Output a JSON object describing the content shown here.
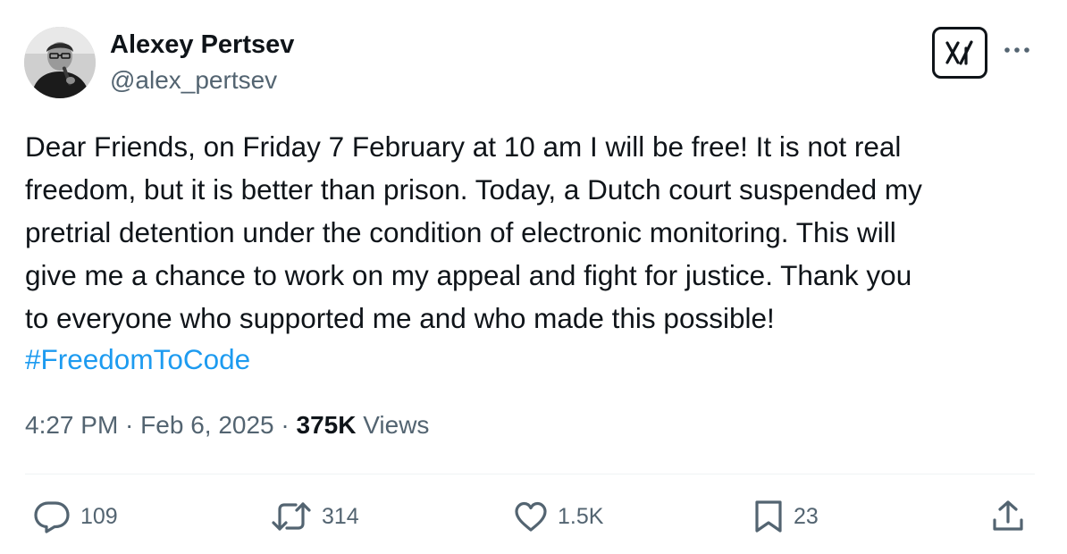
{
  "author": {
    "display_name": "Alexey Pertsev",
    "handle": "@alex_pertsev",
    "avatar_icon": "profile-photo"
  },
  "header_actions": {
    "grok_icon": "grok-icon",
    "more_icon": "more-icon"
  },
  "tweet": {
    "text": "Dear Friends, on Friday 7 February at 10 am I will be free! It is not real\nfreedom, but it is better than prison. Today, a Dutch court suspended my\npretrial detention under the condition of electronic monitoring. This will\ngive me a chance to work on my appeal and fight for justice. Thank you\nto everyone who supported me and who made this possible!",
    "hashtag": "#FreedomToCode"
  },
  "meta": {
    "time": "4:27 PM",
    "separator": " · ",
    "date": "Feb 6, 2025",
    "views_count": "375K",
    "views_label": " Views"
  },
  "actions": {
    "replies": "109",
    "reposts": "314",
    "likes": "1.5K",
    "bookmarks": "23"
  },
  "colors": {
    "text": "#0f1419",
    "secondary": "#536471",
    "link": "#1d9bf0",
    "divider": "#eff3f4"
  }
}
